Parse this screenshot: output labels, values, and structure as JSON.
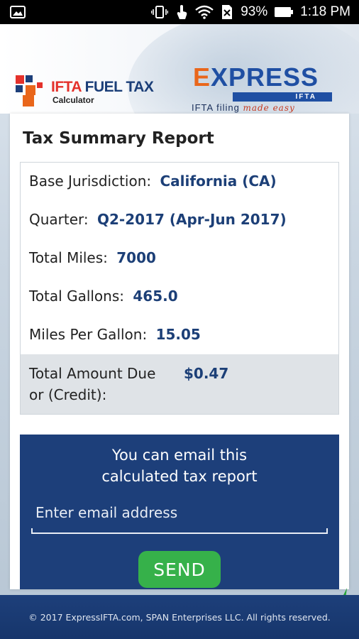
{
  "status_bar": {
    "battery_percent": "93%",
    "time": "1:18 PM"
  },
  "header": {
    "app_logo_title_red": "IFTA",
    "app_logo_title_blue": " FUEL TAX",
    "app_logo_subtitle": "Calculator",
    "brand_name_first": "E",
    "brand_name_rest": "XPRESS",
    "brand_bar": "IFTA",
    "tagline_plain": "IFTA filing ",
    "tagline_script": "made easy"
  },
  "report": {
    "title": "Tax Summary Report",
    "rows": [
      {
        "label": "Base Jurisdiction:",
        "value": "California (CA)"
      },
      {
        "label": "Quarter:",
        "value": "Q2-2017 (Apr-Jun 2017)"
      },
      {
        "label": "Total Miles:",
        "value": "7000"
      },
      {
        "label": "Total Gallons:",
        "value": "465.0"
      },
      {
        "label": "Miles Per Gallon:",
        "value": "15.05"
      }
    ],
    "total_label_line1": "Total Amount Due",
    "total_label_line2": "or (Credit):",
    "total_value": "$0.47"
  },
  "email": {
    "prompt_line1": "You can email this",
    "prompt_line2": "calculated tax report",
    "placeholder": "Enter email address",
    "send_label": "SEND"
  },
  "footer": {
    "copyright": "© 2017 ExpressIFTA.com, SPAN Enterprises LLC. All rights reserved."
  },
  "colors": {
    "brand_blue": "#1d3f7a",
    "value_blue": "#1c3f77",
    "send_green": "#36b14a",
    "accent_orange": "#e9661b",
    "accent_red": "#e4312b"
  }
}
